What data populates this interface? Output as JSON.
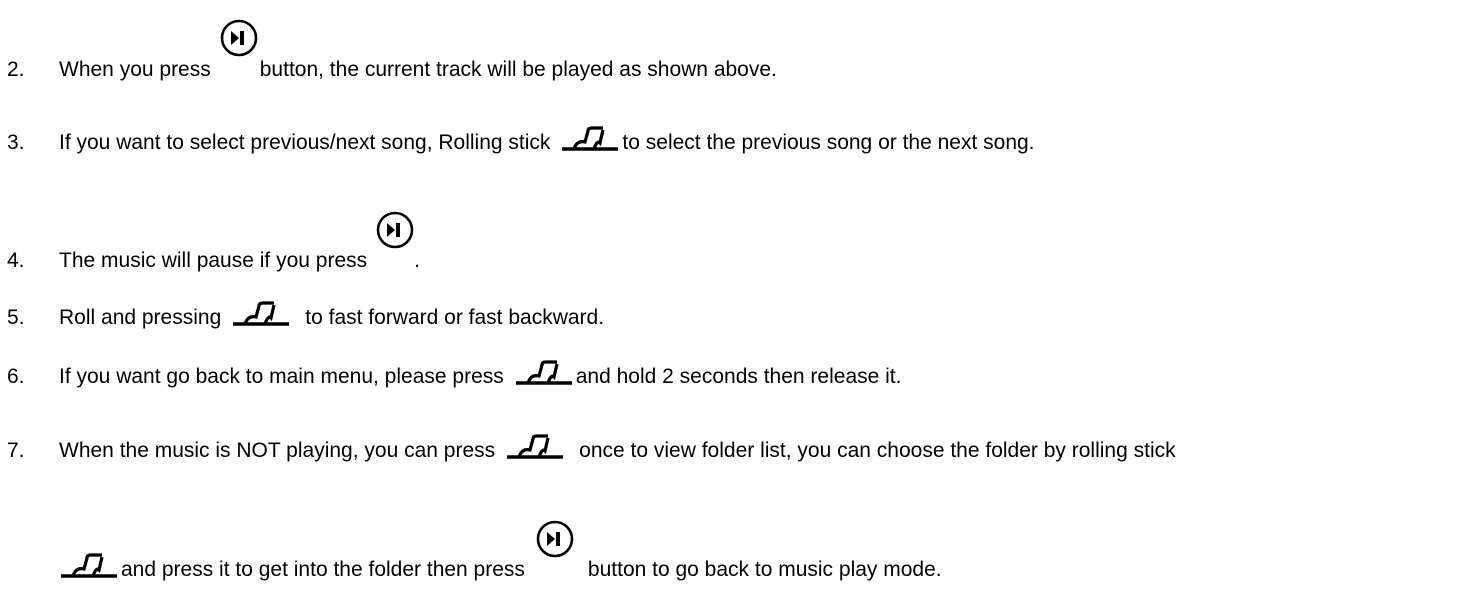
{
  "items": [
    {
      "number": "2.",
      "before": "When you press",
      "after": "button, the current track will be played as shown above.",
      "icon": "play-pause-icon"
    },
    {
      "number": "3.",
      "before": "If you want to select previous/next song, Rolling stick",
      "after": "to select the previous song or the next song.",
      "icon": "rolling-stick-icon"
    },
    {
      "number": "4.",
      "before": "The music will pause if you press",
      "after": ".",
      "icon": "play-pause-icon"
    },
    {
      "number": "5.",
      "before": "Roll and pressing",
      "after": "to fast forward or fast backward.",
      "icon": "rolling-stick-icon"
    },
    {
      "number": "6.",
      "before": "If you want go back to main menu, please press",
      "after": "and hold 2 seconds then release it.",
      "icon": "rolling-stick-icon"
    },
    {
      "number": "7.",
      "before": "When the music is NOT playing, you can press",
      "after": "once to view folder list, you can choose the folder by rolling stick",
      "icon": "rolling-stick-icon"
    },
    {
      "middle": "and press it to get into the folder then press",
      "after": "button to go back to music play mode."
    }
  ]
}
